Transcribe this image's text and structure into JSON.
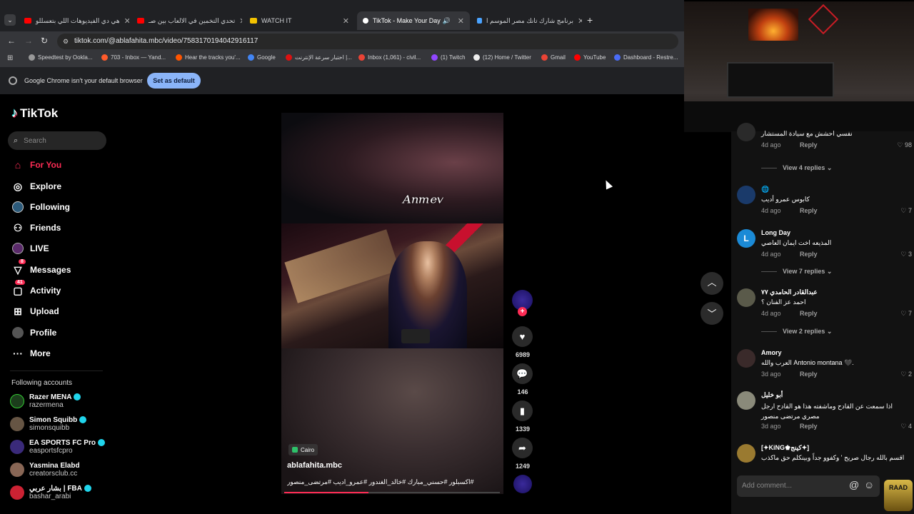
{
  "browser": {
    "tabs": [
      {
        "label": "هي دي الفيديوهات اللي بتعسللو",
        "color": "#ff0000"
      },
      {
        "label": "تحدي التخمين في الالعاب بين صـ",
        "color": "#ff0000"
      },
      {
        "label": "WATCH IT",
        "color": "#f2c200"
      },
      {
        "label": "TikTok - Make Your Day",
        "color": "#ffffff"
      },
      {
        "label": "برنامج شارك تانك مصر الموسم ا",
        "color": "#4aa3ff"
      }
    ],
    "url": "tiktok.com/@ablafahita.mbc/video/7583170194042916117",
    "bookmarks": [
      {
        "label": "Speedtest by Ookla...",
        "color": "#999"
      },
      {
        "label": "703 - Inbox — Yand...",
        "color": "#ff5b2b"
      },
      {
        "label": "Hear the tracks you'...",
        "color": "#ff5500"
      },
      {
        "label": "Google",
        "color": "#4285f4"
      },
      {
        "label": "اختبار سرعة الإنترنت |...",
        "color": "#d11"
      },
      {
        "label": "Inbox (1,061) - civil...",
        "color": "#ea4335"
      },
      {
        "label": "(1) Twitch",
        "color": "#9146ff"
      },
      {
        "label": "(12) Home / Twitter",
        "color": "#eee"
      },
      {
        "label": "Gmail",
        "color": "#ea4335"
      },
      {
        "label": "YouTube",
        "color": "#ff0000"
      },
      {
        "label": "Dashboard - Restre...",
        "color": "#4a6cf7"
      }
    ],
    "infobar_text": "Google Chrome isn't your default browser",
    "set_default_label": "Set as default"
  },
  "sidebar": {
    "logo": "TikTok",
    "search_placeholder": "Search",
    "nav": [
      {
        "label": "For You",
        "icon": "home-icon",
        "active": true
      },
      {
        "label": "Explore",
        "icon": "compass-icon"
      },
      {
        "label": "Following",
        "icon": "following-icon"
      },
      {
        "label": "Friends",
        "icon": "friends-icon"
      },
      {
        "label": "LIVE",
        "icon": "live-icon"
      },
      {
        "label": "Messages",
        "icon": "messages-icon",
        "badge": "8"
      },
      {
        "label": "Activity",
        "icon": "activity-icon",
        "badge": "41"
      },
      {
        "label": "Upload",
        "icon": "upload-icon"
      },
      {
        "label": "Profile",
        "icon": "profile-icon"
      },
      {
        "label": "More",
        "icon": "more-icon"
      }
    ],
    "following_title": "Following accounts",
    "accounts": [
      {
        "name": "Razer MENA",
        "handle": "razermena",
        "color": "#1c3d1c"
      },
      {
        "name": "Simon Squibb",
        "handle": "simonsquibb",
        "color": "#665544"
      },
      {
        "name": "EA SPORTS FC Pro",
        "handle": "easportsfcpro",
        "color": "#3a2a7a"
      },
      {
        "name": "Yasmina Elabd",
        "handle": "creatorsclub.cc",
        "color": "#886655"
      },
      {
        "name": "بشار عربي | FBA",
        "handle": "bashar_arabi",
        "color": "#cc2233"
      }
    ]
  },
  "video": {
    "location": "Cairo",
    "author": "ablafahita.mbc",
    "caption": "#اكسبلور #حسني_مبارك #خالد_الغندور #عمرو_اديب #مرتضى_منصور",
    "likes": "6989",
    "comments": "146",
    "saves": "1339",
    "shares": "1249"
  },
  "comments": [
    {
      "text": "نفسي احشش مع سيادة المستشار",
      "time": "4d ago",
      "reply": "Reply",
      "likes": "98"
    },
    {
      "view_replies": "View 4 replies"
    },
    {
      "user": "🌐",
      "text": "كابوس عمرو أديب",
      "time": "4d ago",
      "reply": "Reply",
      "likes": "7"
    },
    {
      "user": "Long Day",
      "text": "المذيعه اخت ايمان العاصي",
      "time": "4d ago",
      "reply": "Reply",
      "likes": "3",
      "initial": "L"
    },
    {
      "view_replies": "View 7 replies"
    },
    {
      "user": "عبدالقادر الحامدي ٧٧",
      "text": "احمد عز الفنان ؟",
      "time": "4d ago",
      "reply": "Reply",
      "likes": "7"
    },
    {
      "view_replies": "View 2 replies"
    },
    {
      "user": "Amory",
      "text": "العرب والله Antonio montana 🖤.",
      "time": "3d ago",
      "reply": "Reply",
      "likes": "2"
    },
    {
      "user": "أبو خليل",
      "text": "اذا سمعت عن القادح وماشفته هذا هو القادح ارجل مصري مرتضى منصور",
      "time": "3d ago",
      "reply": "Reply",
      "likes": "4"
    },
    {
      "user": "[✦KiNG♚كينج✦]",
      "text": "اقسم بالله رجال صريح ' وكفوو جداً وبينكلم حق ماكذب"
    }
  ],
  "add_comment_placeholder": "Add comment..."
}
